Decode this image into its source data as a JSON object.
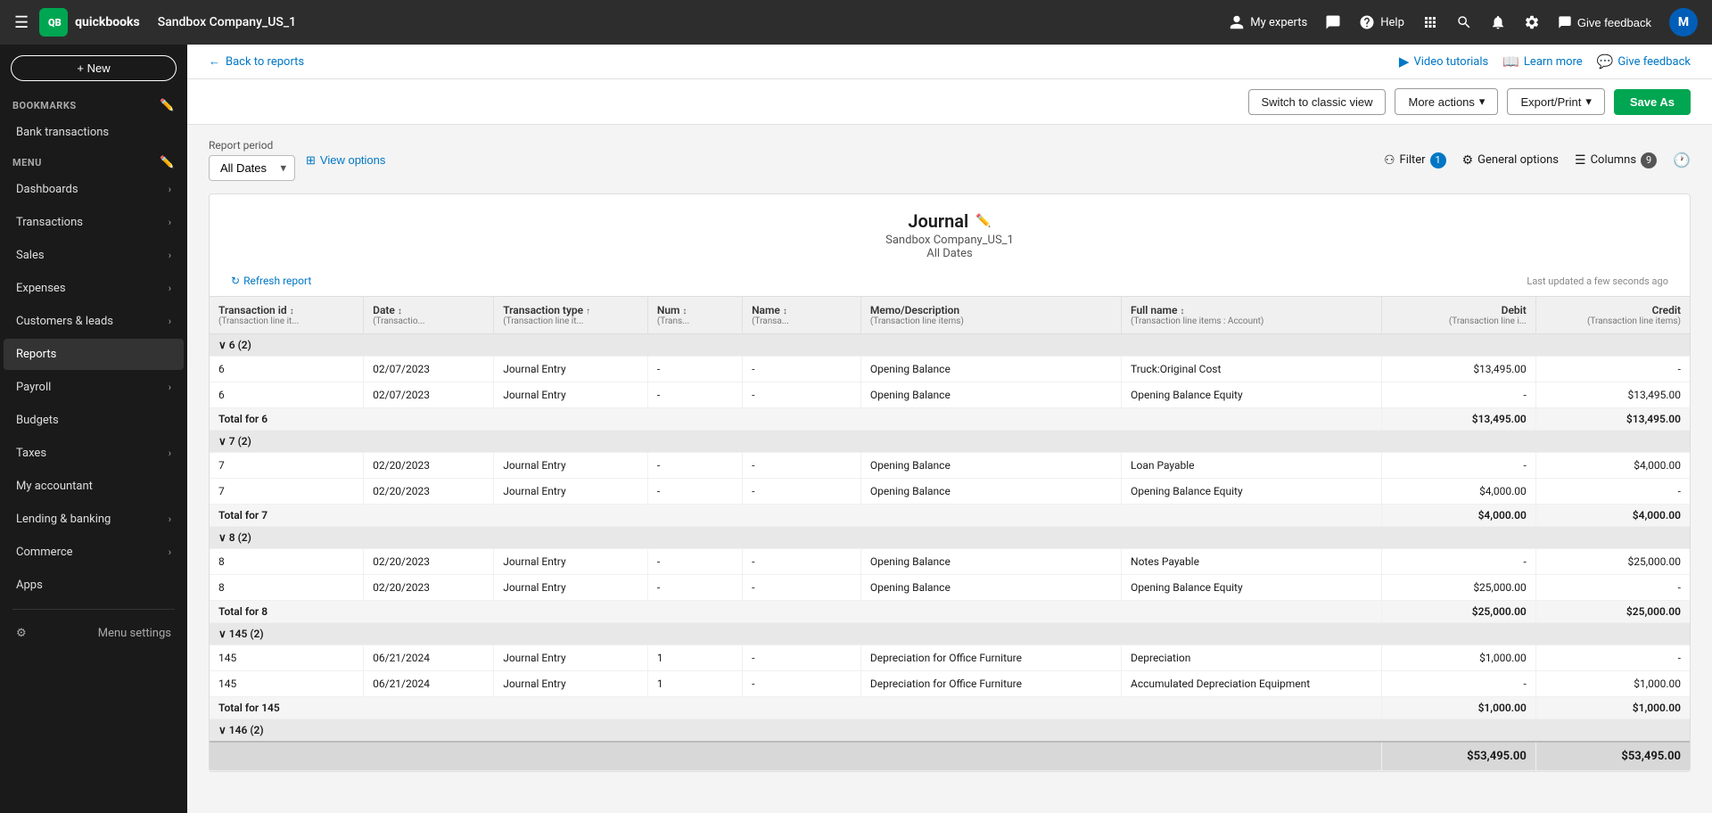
{
  "topnav": {
    "logo_text": "quickbooks",
    "company": "Sandbox Company_US_1",
    "hamburger": "☰",
    "my_experts_label": "My experts",
    "help_label": "Help",
    "give_feedback_label": "Give feedback",
    "avatar_initials": "M"
  },
  "sidebar": {
    "new_button": "+ New",
    "bookmarks_header": "BOOKMARKS",
    "menu_header": "MENU",
    "items": [
      {
        "label": "Bank transactions",
        "has_chevron": false
      },
      {
        "label": "Dashboards",
        "has_chevron": true
      },
      {
        "label": "Transactions",
        "has_chevron": true
      },
      {
        "label": "Sales",
        "has_chevron": true
      },
      {
        "label": "Expenses",
        "has_chevron": true
      },
      {
        "label": "Customers & leads",
        "has_chevron": true
      },
      {
        "label": "Reports",
        "has_chevron": false,
        "active": true
      },
      {
        "label": "Payroll",
        "has_chevron": true
      },
      {
        "label": "Budgets",
        "has_chevron": false
      },
      {
        "label": "Taxes",
        "has_chevron": true
      },
      {
        "label": "My accountant",
        "has_chevron": false
      },
      {
        "label": "Lending & banking",
        "has_chevron": true
      },
      {
        "label": "Commerce",
        "has_chevron": true
      },
      {
        "label": "Apps",
        "has_chevron": false
      }
    ],
    "menu_settings": "Menu settings"
  },
  "subheader": {
    "back_link": "Back to reports",
    "video_tutorials": "Video tutorials",
    "learn_more": "Learn more",
    "give_feedback": "Give feedback"
  },
  "toolbar": {
    "switch_classic": "Switch to classic view",
    "more_actions": "More actions",
    "export_print": "Export/Print",
    "save_as": "Save As"
  },
  "filter_bar": {
    "report_period_label": "Report period",
    "date_value": "All Dates",
    "view_options": "View options",
    "filter_label": "Filter",
    "filter_count": "1",
    "general_options": "General options",
    "columns_label": "Columns",
    "columns_count": "9",
    "clock_icon": "🕐"
  },
  "report": {
    "title": "Journal",
    "subtitle": "Sandbox Company_US_1",
    "date_range": "All Dates",
    "refresh_label": "Refresh report",
    "last_updated": "Last updated a few seconds ago",
    "columns": [
      {
        "label": "Transaction id",
        "sub": "(Transaction line it...",
        "sortable": true,
        "align": "left"
      },
      {
        "label": "Date",
        "sub": "(Transactio...",
        "sortable": true,
        "align": "left"
      },
      {
        "label": "Transaction type",
        "sub": "(Transaction line it...",
        "sortable": true,
        "align": "left"
      },
      {
        "label": "Num",
        "sub": "(Trans...",
        "sortable": true,
        "align": "left"
      },
      {
        "label": "Name",
        "sub": "(Transa...",
        "sortable": true,
        "align": "left"
      },
      {
        "label": "Memo/Description",
        "sub": "(Transaction line items)",
        "sortable": false,
        "align": "left"
      },
      {
        "label": "Full name",
        "sub": "(Transaction line items : Account)",
        "sortable": true,
        "align": "left"
      },
      {
        "label": "Debit",
        "sub": "(Transaction line i...",
        "sortable": false,
        "align": "right"
      },
      {
        "label": "Credit",
        "sub": "(Transaction line items)",
        "sortable": false,
        "align": "right"
      }
    ],
    "groups": [
      {
        "id": "6",
        "count": "2",
        "rows": [
          {
            "txnid": "6",
            "date": "02/07/2023",
            "type": "Journal Entry",
            "num": "-",
            "name": "-",
            "memo": "Opening Balance",
            "fullname": "Truck:Original Cost",
            "debit": "$13,495.00",
            "credit": "-"
          },
          {
            "txnid": "6",
            "date": "02/07/2023",
            "type": "Journal Entry",
            "num": "-",
            "name": "-",
            "memo": "Opening Balance",
            "fullname": "Opening Balance Equity",
            "debit": "-",
            "credit": "$13,495.00"
          }
        ],
        "total_debit": "$13,495.00",
        "total_credit": "$13,495.00"
      },
      {
        "id": "7",
        "count": "2",
        "rows": [
          {
            "txnid": "7",
            "date": "02/20/2023",
            "type": "Journal Entry",
            "num": "-",
            "name": "-",
            "memo": "Opening Balance",
            "fullname": "Loan Payable",
            "debit": "-",
            "credit": "$4,000.00"
          },
          {
            "txnid": "7",
            "date": "02/20/2023",
            "type": "Journal Entry",
            "num": "-",
            "name": "-",
            "memo": "Opening Balance",
            "fullname": "Opening Balance Equity",
            "debit": "$4,000.00",
            "credit": "-"
          }
        ],
        "total_debit": "$4,000.00",
        "total_credit": "$4,000.00"
      },
      {
        "id": "8",
        "count": "2",
        "rows": [
          {
            "txnid": "8",
            "date": "02/20/2023",
            "type": "Journal Entry",
            "num": "-",
            "name": "-",
            "memo": "Opening Balance",
            "fullname": "Notes Payable",
            "debit": "-",
            "credit": "$25,000.00"
          },
          {
            "txnid": "8",
            "date": "02/20/2023",
            "type": "Journal Entry",
            "num": "-",
            "name": "-",
            "memo": "Opening Balance",
            "fullname": "Opening Balance Equity",
            "debit": "$25,000.00",
            "credit": "-"
          }
        ],
        "total_debit": "$25,000.00",
        "total_credit": "$25,000.00"
      },
      {
        "id": "145",
        "count": "2",
        "rows": [
          {
            "txnid": "145",
            "date": "06/21/2024",
            "type": "Journal Entry",
            "num": "1",
            "name": "-",
            "memo": "Depreciation for Office Furniture",
            "fullname": "Depreciation",
            "debit": "$1,000.00",
            "credit": "-"
          },
          {
            "txnid": "145",
            "date": "06/21/2024",
            "type": "Journal Entry",
            "num": "1",
            "name": "-",
            "memo": "Depreciation for Office Furniture",
            "fullname": "Accumulated Depreciation Equipment",
            "debit": "-",
            "credit": "$1,000.00"
          }
        ],
        "total_debit": "$1,000.00",
        "total_credit": "$1,000.00"
      }
    ],
    "grand_total_debit": "$53,495.00",
    "grand_total_credit": "$53,495.00"
  }
}
